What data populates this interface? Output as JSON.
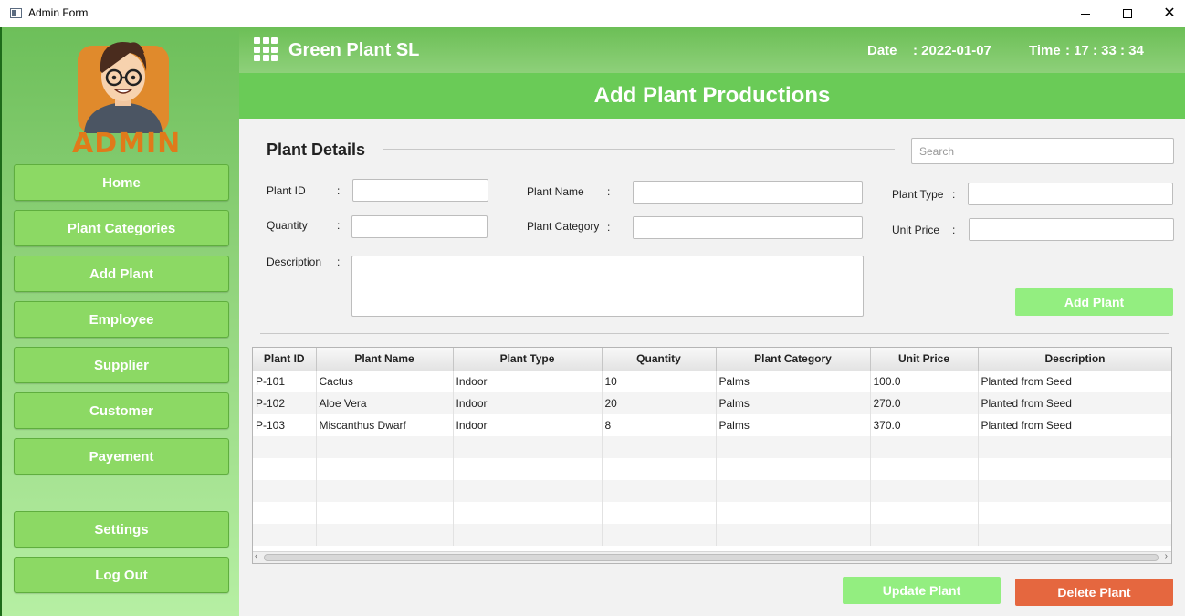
{
  "window": {
    "title": "Admin Form"
  },
  "sidebar": {
    "admin_label": "ADMIN",
    "items": [
      {
        "label": "Home"
      },
      {
        "label": "Plant Categories"
      },
      {
        "label": "Add Plant"
      },
      {
        "label": "Employee"
      },
      {
        "label": "Supplier"
      },
      {
        "label": "Customer"
      },
      {
        "label": "Payement"
      },
      {
        "label": "Settings"
      },
      {
        "label": "Log Out"
      }
    ]
  },
  "header": {
    "brand": "Green Plant SL",
    "date_label": "Date",
    "date_value": ": 2022-01-07",
    "time_label": "Time",
    "time_value": ": 17 : 33 : 34"
  },
  "banner": {
    "title": "Add Plant Productions"
  },
  "form": {
    "section_title": "Plant Details",
    "search_placeholder": "Search",
    "colon": ":",
    "labels": {
      "plant_id": "Plant ID",
      "quantity": "Quantity",
      "description": "Description",
      "plant_name": "Plant Name",
      "plant_category": "Plant Category",
      "plant_type": "Plant Type",
      "unit_price": "Unit Price"
    },
    "add_button": "Add Plant"
  },
  "table": {
    "columns": [
      "Plant ID",
      "Plant Name",
      "Plant Type",
      "Quantity",
      "Plant Category",
      "Unit Price",
      "Description"
    ],
    "rows": [
      [
        "P-101",
        "Cactus",
        "Indoor",
        "10",
        "Palms",
        "100.0",
        "Planted from Seed"
      ],
      [
        "P-102",
        "Aloe Vera",
        "Indoor",
        "20",
        "Palms",
        "270.0",
        "Planted from Seed"
      ],
      [
        "P-103",
        "Miscanthus Dwarf",
        "Indoor",
        "8",
        "Palms",
        "370.0",
        "Planted from Seed"
      ]
    ]
  },
  "actions": {
    "update": "Update Plant",
    "delete": "Delete Plant"
  },
  "colors": {
    "accent_green": "#6acb57",
    "button_green": "#8cd964",
    "disabled_green": "#93ee80",
    "delete_red": "#e5673f",
    "admin_orange": "#e07a1a"
  }
}
